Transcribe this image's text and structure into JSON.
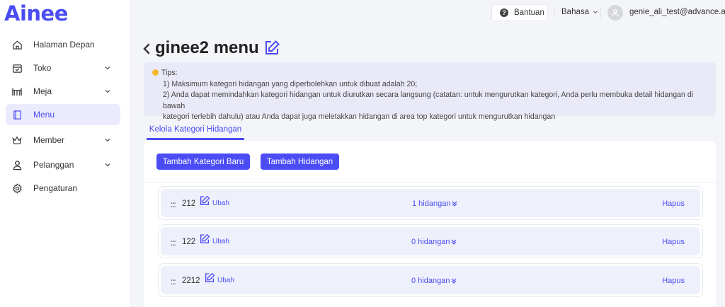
{
  "app": {
    "logo": "Ainee",
    "brand_color": "#4b4cf4"
  },
  "sidebar": {
    "items": [
      {
        "label": "Halaman Depan",
        "icon": "home-icon",
        "has_submenu": false,
        "active": false
      },
      {
        "label": "Toko",
        "icon": "store-icon",
        "has_submenu": true,
        "active": false
      },
      {
        "label": "Meja",
        "icon": "table-icon",
        "has_submenu": true,
        "active": false
      },
      {
        "label": "Menu",
        "icon": "menu-book-icon",
        "has_submenu": false,
        "active": true
      },
      {
        "label": "Member",
        "icon": "crown-icon",
        "has_submenu": true,
        "active": false
      },
      {
        "label": "Pelanggan",
        "icon": "person-icon",
        "has_submenu": true,
        "active": false
      },
      {
        "label": "Pengaturan",
        "icon": "gear-icon",
        "has_submenu": false,
        "active": false
      }
    ]
  },
  "topbar": {
    "help_label": "Bantuan",
    "language_label": "Bahasa",
    "user_email": "genie_ali_test@advance.ai"
  },
  "page": {
    "title": "ginee2 menu",
    "tips": {
      "heading": "Tips:",
      "lines": [
        "1) Maksimum kategori hidangan yang diperbolehkan untuk dibuat adalah 20;",
        "2) Anda dapat memindahkan kategori hidangan untuk diurutkan secara langsung (catatan: untuk mengurutkan kategori, Anda perlu membuka detail hidangan di bawah",
        "kategori terlebih dahulu) atau Anda dapat juga meletakkan hidangan di area top kategori untuk mengurutkan hidangan"
      ]
    },
    "tabs": [
      {
        "label": "Kelola Kategori Hidangan",
        "active": true
      }
    ],
    "buttons": {
      "add_category": "Tambah Kategori Baru",
      "add_dish": "Tambah Hidangan"
    },
    "drag_handle": ":::",
    "edit_label": "Ubah",
    "delete_label": "Hapus",
    "categories": [
      {
        "name": "212",
        "dish_count": "1 hidangan"
      },
      {
        "name": "122",
        "dish_count": "0 hidangan"
      },
      {
        "name": "2212",
        "dish_count": "0 hidangan"
      }
    ]
  }
}
